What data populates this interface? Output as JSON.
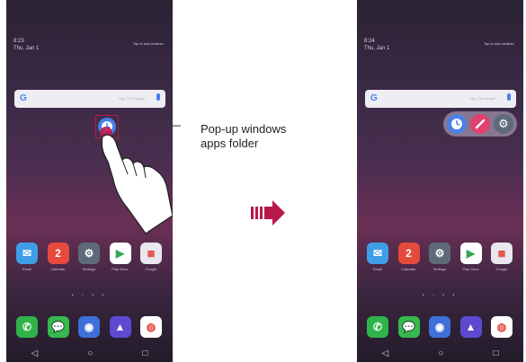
{
  "left_screen": {
    "time": "8:23",
    "date": "Thu, Jan 1",
    "weather_hint": "Tap to add weather",
    "search_placeholder": "Say \"Ok Google\"",
    "apps": [
      "Email",
      "Calendar",
      "Settings",
      "Play Store",
      "Google"
    ],
    "calendar_day": "2",
    "dock": [
      "phone",
      "messages",
      "camera",
      "gallery",
      "chrome"
    ],
    "page_dots": "• ◦ • •",
    "nav": [
      "◁",
      "○",
      "□"
    ]
  },
  "right_screen": {
    "time": "8:24",
    "date": "Thu, Jan 1",
    "weather_hint": "Tap to add weather",
    "search_placeholder": "Say \"Ok Google\"",
    "apps": [
      "Email",
      "Calendar",
      "Settings",
      "Play Store",
      "Google"
    ],
    "calendar_day": "2",
    "dock": [
      "phone",
      "messages",
      "camera",
      "gallery",
      "chrome"
    ],
    "page_dots": "• ◦ • •",
    "nav": [
      "◁",
      "○",
      "□"
    ],
    "folder_apps": [
      "clock-icon",
      "pen-icon",
      "gear-icon"
    ]
  },
  "callout": {
    "line1": "Pop-up windows",
    "line2": "apps folder"
  },
  "colors": {
    "accent": "#b8184a",
    "folder_blue": "#4a80e8",
    "pen_pink": "#e2416f"
  }
}
